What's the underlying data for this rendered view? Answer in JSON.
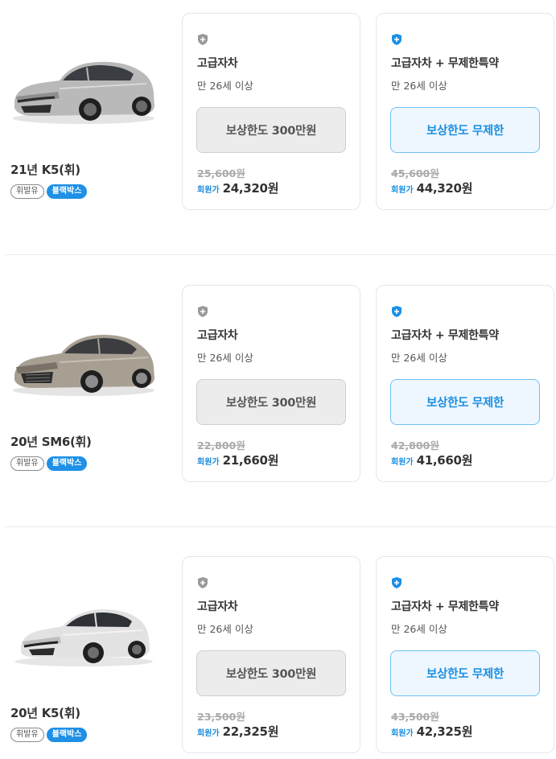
{
  "colors": {
    "accent": "#1a8ee0",
    "tag_blackbox": "#1e90e6",
    "coverage_basic_bg": "#ececec",
    "coverage_premium_bg": "#eef7ff",
    "shield_basic": "#9a9a9a",
    "shield_premium": "#1e90e6"
  },
  "rows": [
    {
      "car": {
        "name": "21년 K5(휘)",
        "image": "silver-sedan-k5-2021",
        "tags": {
          "fuel": "휘발유",
          "blackbox": "블랙박스"
        }
      },
      "plans": [
        {
          "icon": "shield-gray-icon",
          "title": "고급자차",
          "age": "만 26세 이상",
          "coverage": "보상한도 300만원",
          "original_price": "25,600원",
          "member_label": "회원가",
          "member_price": "24,320원"
        },
        {
          "icon": "shield-blue-icon",
          "title": "고급자차 + 무제한특약",
          "age": "만 26세 이상",
          "coverage": "보상한도 무제한",
          "original_price": "45,600원",
          "member_label": "회원가",
          "member_price": "44,320원"
        }
      ]
    },
    {
      "car": {
        "name": "20년 SM6(휘)",
        "image": "champagne-sedan-sm6-2020",
        "tags": {
          "fuel": "휘발유",
          "blackbox": "블랙박스"
        }
      },
      "plans": [
        {
          "icon": "shield-gray-icon",
          "title": "고급자차",
          "age": "만 26세 이상",
          "coverage": "보상한도 300만원",
          "original_price": "22,800원",
          "member_label": "회원가",
          "member_price": "21,660원"
        },
        {
          "icon": "shield-blue-icon",
          "title": "고급자차 + 무제한특약",
          "age": "만 26세 이상",
          "coverage": "보상한도 무제한",
          "original_price": "42,800원",
          "member_label": "회원가",
          "member_price": "41,660원"
        }
      ]
    },
    {
      "car": {
        "name": "20년 K5(휘)",
        "image": "white-sedan-k5-2020",
        "tags": {
          "fuel": "휘발유",
          "blackbox": "블랙박스"
        }
      },
      "plans": [
        {
          "icon": "shield-gray-icon",
          "title": "고급자차",
          "age": "만 26세 이상",
          "coverage": "보상한도 300만원",
          "original_price": "23,500원",
          "member_label": "회원가",
          "member_price": "22,325원"
        },
        {
          "icon": "shield-blue-icon",
          "title": "고급자차 + 무제한특약",
          "age": "만 26세 이상",
          "coverage": "보상한도 무제한",
          "original_price": "43,500원",
          "member_label": "회원가",
          "member_price": "42,325원"
        }
      ]
    }
  ]
}
